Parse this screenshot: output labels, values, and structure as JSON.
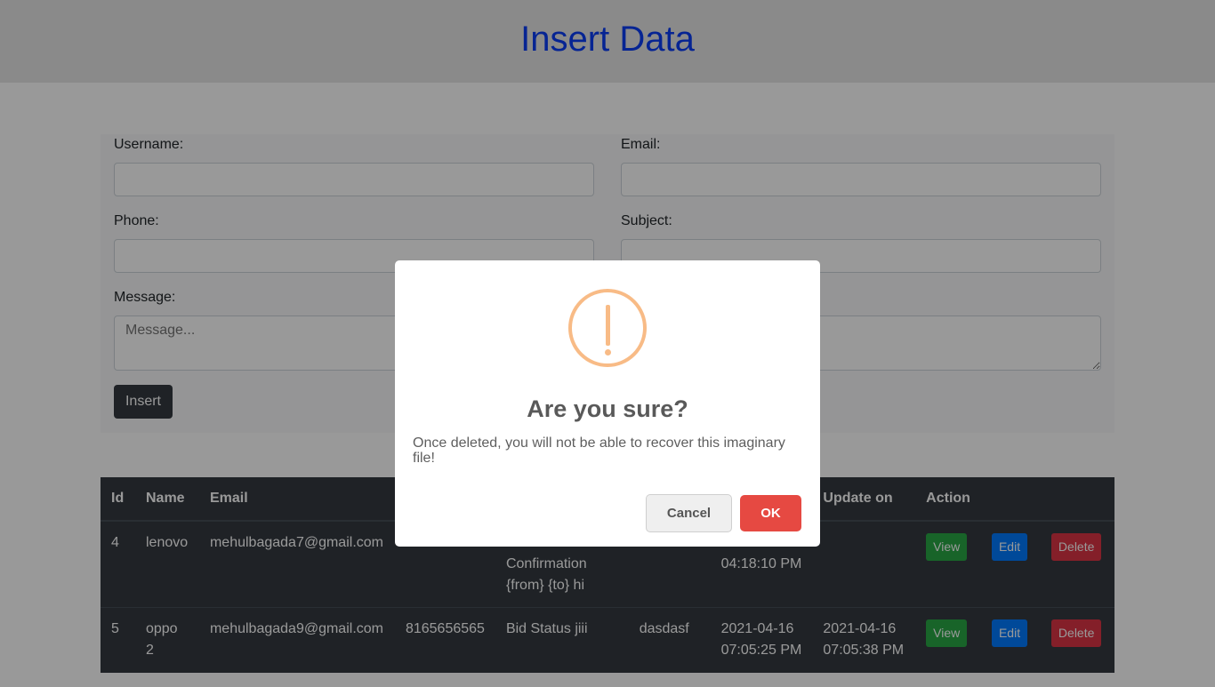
{
  "header": {
    "title": "Insert Data"
  },
  "form": {
    "username_label": "Username:",
    "email_label": "Email:",
    "phone_label": "Phone:",
    "subject_label": "Subject:",
    "message_label": "Message:",
    "message_placeholder": "Message...",
    "insert_label": "Insert"
  },
  "table": {
    "headers": {
      "id": "Id",
      "name": "Name",
      "email": "Email",
      "phone": "",
      "subject": "",
      "message": "",
      "created": "",
      "update": "Update on",
      "action": "Action"
    },
    "rows": [
      {
        "id": "4",
        "name": "lenovo",
        "email": "mehulbagada7@gmail.com",
        "phone": "",
        "subject": "Confirmation {from} {to} hi",
        "message": "",
        "created": "04:18:10 PM",
        "update": "",
        "view": "View",
        "edit": "Edit",
        "delete": "Delete"
      },
      {
        "id": "5",
        "name": "oppo 2",
        "email": "mehulbagada9@gmail.com",
        "phone": "8165656565",
        "subject": "Bid Status jiii",
        "message": "dasdasf",
        "created": "2021-04-16 07:05:25 PM",
        "update": "2021-04-16 07:05:38 PM",
        "view": "View",
        "edit": "Edit",
        "delete": "Delete"
      }
    ]
  },
  "modal": {
    "title": "Are you sure?",
    "text": "Once deleted, you will not be able to recover this imaginary file!",
    "cancel_label": "Cancel",
    "ok_label": "OK",
    "icon": "warning-icon"
  },
  "colors": {
    "title": "#0b3df5",
    "warning": "#f8bb86",
    "ok_button": "#e64942",
    "view_button": "#28a745",
    "edit_button": "#007bff",
    "delete_button": "#dc3545"
  }
}
